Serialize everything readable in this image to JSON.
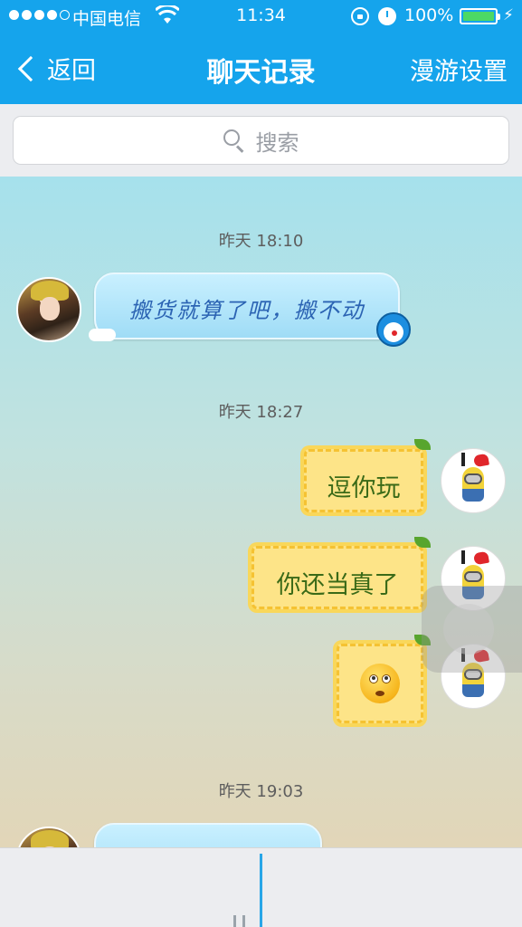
{
  "status_bar": {
    "carrier": "中国电信",
    "time": "11:34",
    "battery_percent": "100%",
    "battery_color": "#4cd964",
    "icons": [
      "signal-dots-icon",
      "wifi-icon",
      "orientation-lock-icon",
      "alarm-icon",
      "battery-icon",
      "charging-bolt-icon"
    ]
  },
  "nav": {
    "back_label": "返回",
    "title": "聊天记录",
    "right_label": "漫游设置",
    "bar_color": "#15a4ec"
  },
  "search": {
    "placeholder": "搜索",
    "icon": "search-icon"
  },
  "messages": [
    {
      "type": "timestamp",
      "text": "昨天 18:10"
    },
    {
      "type": "message",
      "side": "left",
      "sender_avatar": "avatar-girl",
      "text": "搬货就算了吧，搬不动",
      "bubble_style": "blue-doraemon"
    },
    {
      "type": "timestamp",
      "text": "昨天 18:27"
    },
    {
      "type": "message",
      "side": "right",
      "sender_avatar": "avatar-minion",
      "text": "逗你玩",
      "bubble_style": "yellow-star"
    },
    {
      "type": "message",
      "side": "right",
      "sender_avatar": "avatar-minion",
      "text": "你还当真了",
      "bubble_style": "yellow-star"
    },
    {
      "type": "message",
      "side": "right",
      "sender_avatar": "avatar-minion",
      "text": "",
      "emoji": "eyes-up-emoji",
      "bubble_style": "yellow-star"
    },
    {
      "type": "timestamp",
      "text": "昨天 19:03"
    },
    {
      "type": "message",
      "side": "left",
      "sender_avatar": "avatar-girl",
      "text": "",
      "bubble_style": "blue-doraemon",
      "partially_visible": true
    }
  ],
  "colors": {
    "left_bubble_text": "#2b63b3",
    "right_bubble_text": "#3a6a18",
    "timeline_accent": "#28a6e8"
  }
}
